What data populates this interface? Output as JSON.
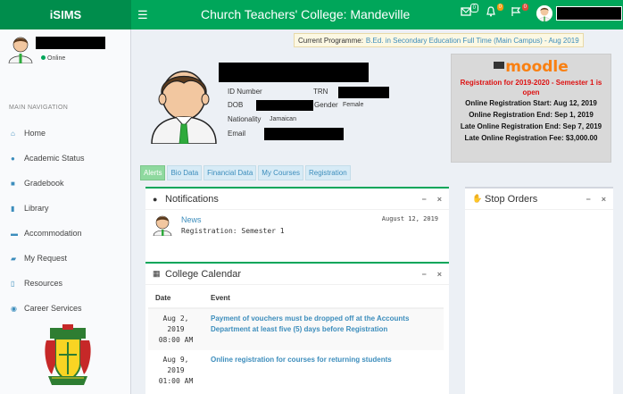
{
  "header": {
    "brand": "iSIMS",
    "menu_icon": "hamburger-icon",
    "title": "Church Teachers' College: Mandeville",
    "icons": [
      {
        "name": "messages-icon",
        "badge": "0"
      },
      {
        "name": "bell-icon",
        "badge": "0"
      },
      {
        "name": "flag-icon",
        "badge": "0"
      }
    ]
  },
  "sidebar": {
    "status": "Online",
    "nav_header": "MAIN NAVIGATION",
    "items": [
      {
        "label": "Home",
        "icon": "home-icon"
      },
      {
        "label": "Academic Status",
        "icon": "info-icon"
      },
      {
        "label": "Gradebook",
        "icon": "book-icon"
      },
      {
        "label": "Library",
        "icon": "library-icon"
      },
      {
        "label": "Accommodation",
        "icon": "bed-icon"
      },
      {
        "label": "My Request",
        "icon": "truck-icon"
      },
      {
        "label": "Resources",
        "icon": "file-icon"
      },
      {
        "label": "Career Services",
        "icon": "pin-icon"
      }
    ]
  },
  "programme": {
    "label": "Current Programme:",
    "value": "B.Ed. in Secondary Education Full Time (Main Campus) - Aug 2019"
  },
  "profile": {
    "id_label": "ID Number",
    "trn_label": "TRN",
    "dob_label": "DOB",
    "gender_label": "Gender",
    "gender_value": "Female",
    "nationality_label": "Nationality",
    "nationality_value": "Jamaican",
    "email_label": "Email"
  },
  "moodle": {
    "logo": "moodle",
    "registration": "Registration for 2019-2020 - Semester 1 is open",
    "lines": [
      "Online Registration Start: Aug 12, 2019",
      "Online Registration End: Sep 1, 2019",
      "Late Online Registration End: Sep 7, 2019",
      "Late Online Registration Fee: $3,000.00"
    ]
  },
  "tabs": [
    "Alerts",
    "Bio Data",
    "Financial Data",
    "My Courses",
    "Registration"
  ],
  "notifications": {
    "title": "Notifications",
    "news_title": "News",
    "news_text": "Registration: Semester 1",
    "news_date": "August 12, 2019"
  },
  "stop_orders": {
    "title": "Stop Orders"
  },
  "calendar": {
    "title": "College Calendar",
    "col_date": "Date",
    "col_event": "Event",
    "rows": [
      {
        "date1": "Aug 2, 2019",
        "date2": "08:00 AM",
        "event": "Payment of vouchers must be dropped off at the Accounts Department at least five (5) days before Registration"
      },
      {
        "date1": "Aug 9, 2019",
        "date2": "01:00 AM",
        "event": "Online registration for courses for returning students"
      }
    ]
  },
  "box_tools": {
    "minimize": "−",
    "close": "×"
  }
}
